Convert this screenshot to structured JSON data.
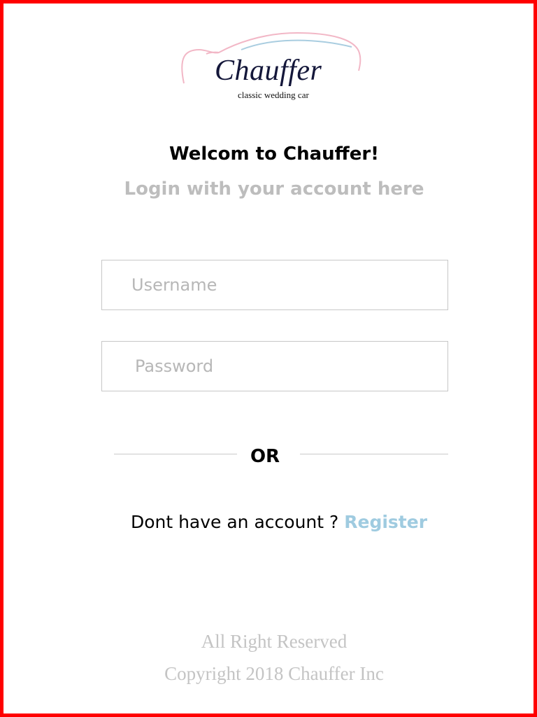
{
  "logo": {
    "wordmark": "Chauffer",
    "tagline": "classic wedding car",
    "colors": {
      "swoosh_pink": "#f2b7c6",
      "swoosh_blue": "#a9cde0",
      "text": "#14173a"
    }
  },
  "heading": {
    "title": "Welcom to Chauffer!",
    "subtitle": "Login with your account here"
  },
  "form": {
    "username_placeholder": "Username",
    "username_value": "",
    "password_placeholder": "Password",
    "password_value": ""
  },
  "divider": {
    "label": "OR"
  },
  "register": {
    "prompt": "Dont have an account ? ",
    "link_label": "Register",
    "link_color": "#9fcbe0"
  },
  "footer": {
    "line1": "All Right Reserved",
    "line2": "Copyright 2018 Chauffer Inc"
  },
  "colors": {
    "frame_border": "#ff0000",
    "muted_text": "#bdbdbd",
    "field_border": "#c7c7c7"
  }
}
